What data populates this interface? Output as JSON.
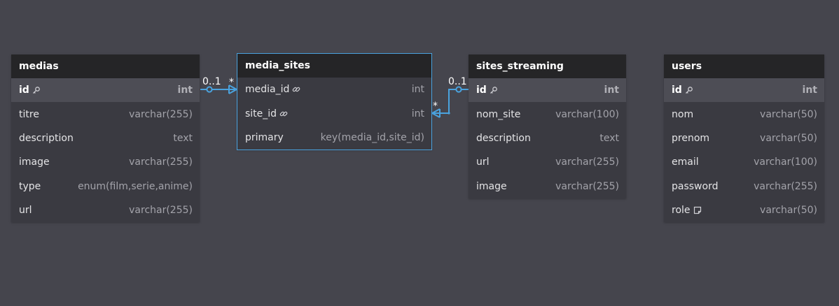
{
  "accent_color": "#4aa3df",
  "tables": {
    "medias": {
      "name": "medias",
      "fields": [
        {
          "name": "id",
          "type": "int",
          "icon": "key-icon"
        },
        {
          "name": "titre",
          "type": "varchar(255)"
        },
        {
          "name": "description",
          "type": "text"
        },
        {
          "name": "image",
          "type": "varchar(255)"
        },
        {
          "name": "type",
          "type": "enum(film,serie,anime)"
        },
        {
          "name": "url",
          "type": "varchar(255)"
        }
      ]
    },
    "media_sites": {
      "name": "media_sites",
      "fields": [
        {
          "name": "media_id",
          "type": "int",
          "icon": "link-icon"
        },
        {
          "name": "site_id",
          "type": "int",
          "icon": "link-icon"
        },
        {
          "name": "primary",
          "type": "key(media_id,site_id)"
        }
      ]
    },
    "sites_streaming": {
      "name": "sites_streaming",
      "fields": [
        {
          "name": "id",
          "type": "int",
          "icon": "key-icon"
        },
        {
          "name": "nom_site",
          "type": "varchar(100)"
        },
        {
          "name": "description",
          "type": "text"
        },
        {
          "name": "url",
          "type": "varchar(255)"
        },
        {
          "name": "image",
          "type": "varchar(255)"
        }
      ]
    },
    "users": {
      "name": "users",
      "fields": [
        {
          "name": "id",
          "type": "int",
          "icon": "key-icon"
        },
        {
          "name": "nom",
          "type": "varchar(50)"
        },
        {
          "name": "prenom",
          "type": "varchar(50)"
        },
        {
          "name": "email",
          "type": "varchar(100)"
        },
        {
          "name": "password",
          "type": "varchar(255)"
        },
        {
          "name": "role",
          "type": "varchar(50)",
          "icon": "note-icon"
        }
      ]
    }
  },
  "relationships": [
    {
      "from": "medias.id",
      "to": "media_sites.media_id",
      "from_cardinality": "0..1",
      "to_cardinality": "*"
    },
    {
      "from": "sites_streaming.id",
      "to": "media_sites.site_id",
      "from_cardinality": "0..1",
      "to_cardinality": "*"
    }
  ]
}
